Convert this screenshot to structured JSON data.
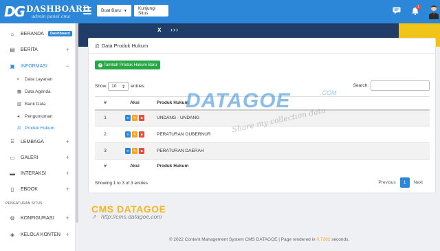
{
  "header": {
    "logo_mark": "DG",
    "logo_title": "DASHBOARD",
    "logo_subtitle": "admin panel cms",
    "buttons": {
      "new": "Buat Baru",
      "visit": "Kunjungi Situs"
    },
    "notification_count": "1"
  },
  "sidebar": {
    "items": [
      {
        "label": "BERANDA",
        "badge": "Dashboard",
        "icon": "home-icon"
      },
      {
        "label": "BERITA",
        "icon": "newspaper-icon"
      },
      {
        "label": "INFORMASI",
        "icon": "info-folder-icon"
      },
      {
        "label": "LEMBAGA",
        "icon": "institution-icon"
      },
      {
        "label": "GALERI",
        "icon": "gallery-icon"
      },
      {
        "label": "INTERAKSI",
        "icon": "chat-icon"
      },
      {
        "label": "EBOOK",
        "icon": "book-icon"
      },
      {
        "label": "KONFIGURASI",
        "icon": "cogs-icon"
      },
      {
        "label": "KELOLA KONTEN",
        "icon": "dropbox-icon"
      }
    ],
    "sub_items": [
      "Data Layanan",
      "Data Agenda",
      "Bank Data",
      "Pengumuman",
      "Produk Hukum"
    ],
    "section_label": "PENGATURAN SITUS"
  },
  "card": {
    "title": "Data Produk Hukum",
    "add_button": "Tambah Produk Hukum Baru",
    "show_label": "Show",
    "show_value": "10",
    "entries_label": "entries",
    "search_label": "Search:",
    "columns": [
      "#",
      "Aksi",
      "Produk Hukum"
    ],
    "rows": [
      {
        "no": "1",
        "name": "UNDANG - UNDANG"
      },
      {
        "no": "2",
        "name": "PERATURAN GUBERNUR"
      },
      {
        "no": "3",
        "name": "PERATURAN DAERAH"
      }
    ],
    "info": "Showing 1 to 3 of 3 entries",
    "pagination": {
      "previous": "Previous",
      "page": "1",
      "next": "Next"
    }
  },
  "watermark": {
    "brand": "DATAGOE",
    "tld": ".COM",
    "tagline": "Share my collection data"
  },
  "branding": {
    "title": "CMS DATAGOE",
    "url": "http://cms.datagoe.com"
  },
  "footer": {
    "prefix": "© 2022 Content Management System CMS DATAGOE | Page rendered in",
    "time": "0.7262",
    "suffix": "seconds."
  },
  "colors": {
    "primary": "#2c87d8",
    "success": "#28a745",
    "warning": "#f5a623",
    "danger": "#e74c3c",
    "accent": "#f5b51e"
  }
}
